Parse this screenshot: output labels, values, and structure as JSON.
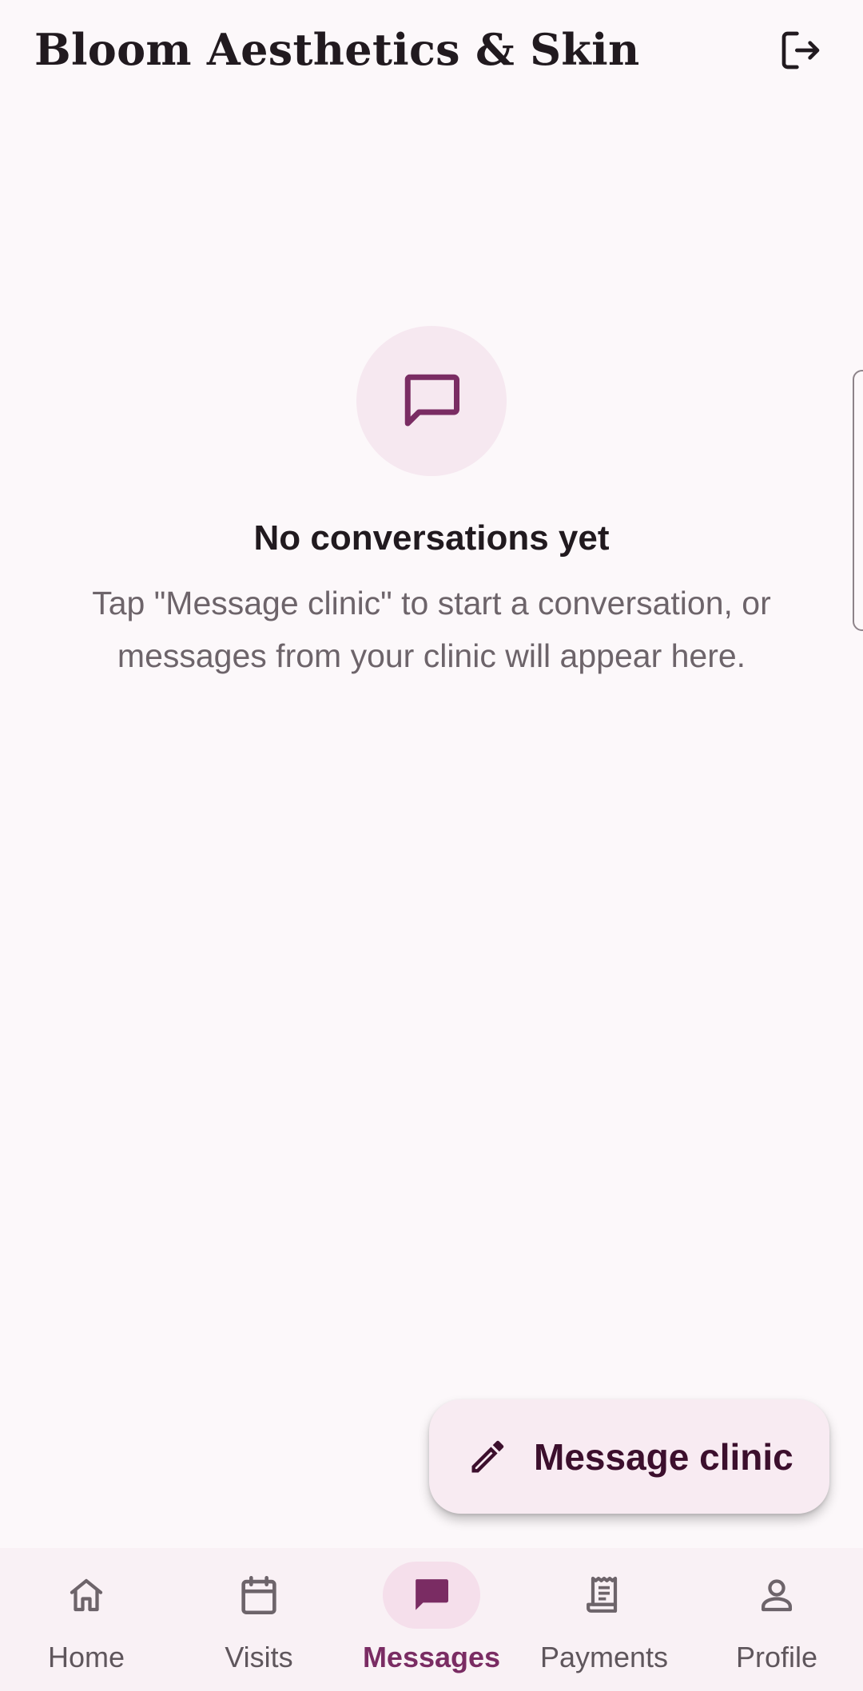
{
  "app_bar": {
    "title": "Bloom Aesthetics & Skin",
    "logout_icon": "logout-icon"
  },
  "empty_state": {
    "icon": "chat-bubble-icon",
    "title": "No conversations yet",
    "description": "Tap \"Message clinic\" to start a conversation, or messages from your clinic will appear here."
  },
  "fab": {
    "icon": "pencil-icon",
    "label": "Message clinic"
  },
  "bottom_nav": {
    "active": "Messages",
    "items": [
      {
        "label": "Home",
        "icon": "home-icon"
      },
      {
        "label": "Visits",
        "icon": "calendar-icon"
      },
      {
        "label": "Messages",
        "icon": "chat-bubble-icon"
      },
      {
        "label": "Payments",
        "icon": "receipt-icon"
      },
      {
        "label": "Profile",
        "icon": "person-icon"
      }
    ]
  },
  "colors": {
    "background": "#fcf8fa",
    "primary": "#7a2c63",
    "primary_container": "#f5dfeb",
    "on_surface": "#211a1f",
    "on_surface_variant": "#6d646a"
  }
}
